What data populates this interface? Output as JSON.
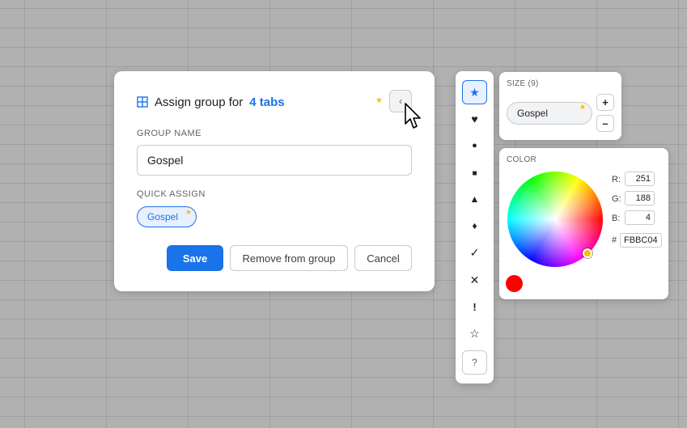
{
  "dialog": {
    "title": "Assign group for",
    "tab_count": "4 tabs",
    "header_star": "★",
    "collapse_glyph": "‹",
    "group_name_label": "GROUP NAME",
    "group_name_value": "Gospel",
    "quick_assign_label": "QUICK ASSIGN",
    "quick_assign_chip": "Gospel",
    "chip_star": "★",
    "save_label": "Save",
    "remove_label": "Remove from group",
    "cancel_label": "Cancel"
  },
  "symbols": {
    "items": [
      {
        "glyph": "★",
        "icon": "star-filled-icon",
        "active": true
      },
      {
        "glyph": "♥",
        "icon": "heart-icon"
      },
      {
        "glyph": "●",
        "icon": "circle-icon"
      },
      {
        "glyph": "■",
        "icon": "square-icon"
      },
      {
        "glyph": "▲",
        "icon": "triangle-icon"
      },
      {
        "glyph": "♦",
        "icon": "diamond-icon"
      },
      {
        "glyph": "✓",
        "icon": "check-icon"
      },
      {
        "glyph": "✕",
        "icon": "cross-icon"
      },
      {
        "glyph": "!",
        "icon": "exclamation-icon"
      },
      {
        "glyph": "☆",
        "icon": "star-outline-icon"
      },
      {
        "glyph": "?",
        "icon": "question-icon"
      }
    ]
  },
  "size_panel": {
    "label": "SIZE (9)",
    "chip_text": "Gospel",
    "chip_star": "★",
    "plus": "+",
    "minus": "–"
  },
  "color_panel": {
    "label": "COLOR",
    "r_label": "R:",
    "r_value": "251",
    "g_label": "G:",
    "g_value": "188",
    "b_label": "B:",
    "b_value": "4",
    "hash_label": "#",
    "hex_value": "FBBC04"
  },
  "colors": {
    "accent": "#1a73e8",
    "selected_color": "#FBBC04",
    "star": "#FBBC04",
    "swatch": "#FF0000"
  }
}
